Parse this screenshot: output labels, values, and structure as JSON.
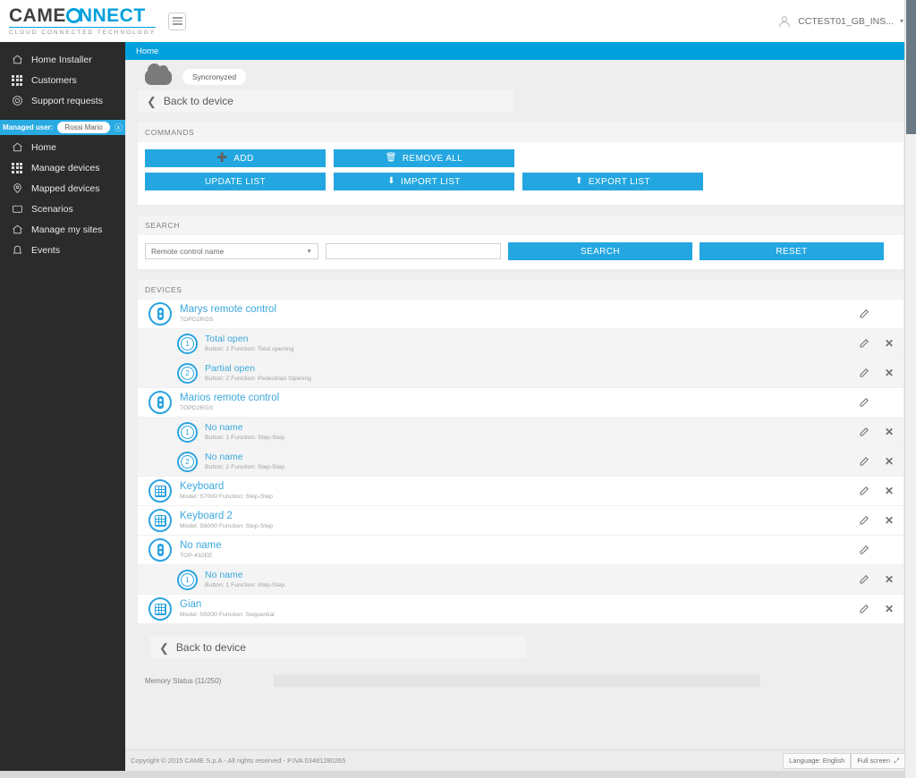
{
  "brand": {
    "name_part1": "CAME",
    "name_part2": "NNECT",
    "tagline": "CLOUD CONNECTED TECHNOLOGY",
    "accent": "#00a0dd"
  },
  "topbar": {
    "menu_icon": "hamburger-icon",
    "user_icon": "user-avatar-icon",
    "user_name": "CCTEST01_GB_INS...",
    "caret": "⌄"
  },
  "sidebar": {
    "group1": [
      {
        "label": "Home Installer",
        "icon": "home-icon"
      },
      {
        "label": "Customers",
        "icon": "grid-icon"
      },
      {
        "label": "Support requests",
        "icon": "support-icon"
      }
    ],
    "managed_user": {
      "label": "Managed user:",
      "value": "Rossi Mario",
      "close_icon": "close-circle-icon"
    },
    "group2": [
      {
        "label": "Home",
        "icon": "home-icon"
      },
      {
        "label": "Manage devices",
        "icon": "grid-icon"
      },
      {
        "label": "Mapped devices",
        "icon": "map-pin-icon"
      },
      {
        "label": "Scenarios",
        "icon": "window-icon"
      },
      {
        "label": "Manage my sites",
        "icon": "home-icon"
      },
      {
        "label": "Events",
        "icon": "bell-icon"
      }
    ]
  },
  "breadcrumb": {
    "label": "Home"
  },
  "sync": {
    "cloud_icon": "cloud-icon",
    "status": "Syncronyzed"
  },
  "back_top": {
    "label": "Back to device",
    "icon": "chevron-left-icon"
  },
  "back_bottom": {
    "label": "Back to device",
    "icon": "chevron-left-icon"
  },
  "commands": {
    "title": "COMMANDS",
    "buttons": [
      {
        "label": "ADD",
        "icon": "plus-icon",
        "glyph": "➕"
      },
      {
        "label": "REMOVE ALL",
        "icon": "trash-icon",
        "glyph": "🗑"
      },
      {
        "label": "UPDATE LIST",
        "icon": "",
        "glyph": ""
      },
      {
        "label": "IMPORT LIST",
        "icon": "arrow-down-icon",
        "glyph": "↓"
      },
      {
        "label": "EXPORT LIST",
        "icon": "arrow-up-icon",
        "glyph": "↑"
      }
    ]
  },
  "search": {
    "title": "SEARCH",
    "filter_selected": "Remote control name",
    "query_value": "",
    "query_placeholder": "",
    "search_label": "SEARCH",
    "reset_label": "RESET"
  },
  "devices": {
    "title": "DEVICES",
    "rows": [
      {
        "level": "parent",
        "icon": "remote-control-icon",
        "name": "Marys remote control",
        "sub": "TOPD2RGS",
        "edit": true,
        "remove": false
      },
      {
        "level": "child",
        "icon": "button-1-icon",
        "num": "1",
        "name": "Total open",
        "sub": "Button: 1 Function: Total opening",
        "edit": true,
        "remove": true
      },
      {
        "level": "child",
        "icon": "button-2-icon",
        "num": "2",
        "name": "Partial open",
        "sub": "Button: 2 Function: Pedestrian Opening",
        "edit": true,
        "remove": true
      },
      {
        "level": "parent",
        "icon": "remote-control-icon",
        "name": "Marios remote control",
        "sub": "TOPD2RGS",
        "edit": true,
        "remove": false
      },
      {
        "level": "child",
        "icon": "button-1-icon",
        "num": "1",
        "name": "No name",
        "sub": "Button: 1 Function: Step-Step",
        "edit": true,
        "remove": true
      },
      {
        "level": "child",
        "icon": "button-2-icon",
        "num": "2",
        "name": "No name",
        "sub": "Button: 2 Function: Step-Step",
        "edit": true,
        "remove": true
      },
      {
        "level": "parent",
        "icon": "keyboard-icon",
        "name": "Keyboard",
        "sub": "Model: S7000 Function: Step-Step",
        "edit": true,
        "remove": true
      },
      {
        "level": "parent",
        "icon": "keyboard-icon",
        "name": "Keyboard 2",
        "sub": "Model: S6000 Function: Step-Step",
        "edit": true,
        "remove": true
      },
      {
        "level": "parent",
        "icon": "remote-control-icon",
        "name": "No name",
        "sub": "TOP-432EE",
        "edit": true,
        "remove": false
      },
      {
        "level": "child",
        "icon": "button-1-icon",
        "num": "1",
        "name": "No name",
        "sub": "Button: 1 Function: Step-Step",
        "edit": true,
        "remove": true
      },
      {
        "level": "parent",
        "icon": "keyboard-icon",
        "name": "Gian",
        "sub": "Model: S5000 Function: Sequential",
        "edit": true,
        "remove": true
      }
    ],
    "edit_icon": "pencil-icon",
    "remove_icon": "close-x-icon"
  },
  "memory": {
    "label": "Memory Status (11/250)",
    "used": 11,
    "total": 250,
    "percent": 4.4,
    "fill_color": "#3d82a0"
  },
  "footer": {
    "copyright": "Copyright © 2015 CAME S.p.A - All rights reserved - P.IVA 03481280265",
    "language_label": "Language: English",
    "fullscreen_label": "Full screen",
    "fullscreen_icon": "expand-icon"
  }
}
